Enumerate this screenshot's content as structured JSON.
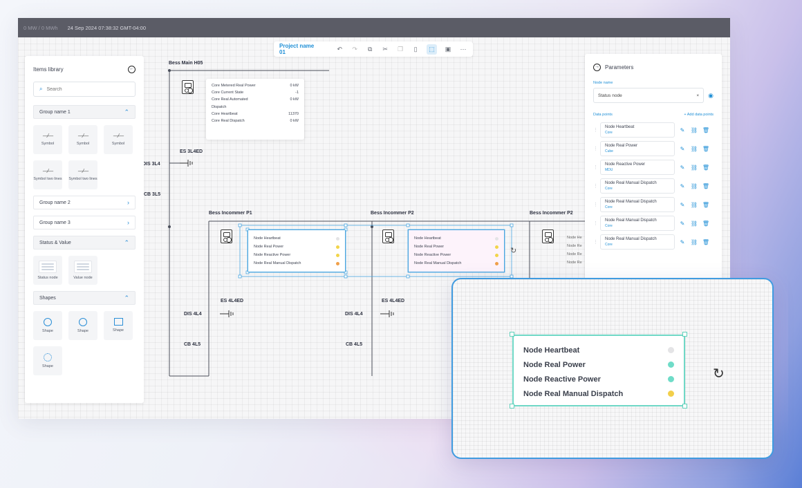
{
  "topbar": {
    "mw": "0 MW / 0 MWh",
    "datetime": "24 Sep 2024 07:38:32 GMT-04:00"
  },
  "toolbar": {
    "project_name": "Project name 01",
    "icons": [
      "undo-icon",
      "redo-icon",
      "copy-icon",
      "cut-icon",
      "duplicate-icon",
      "paste-icon",
      "select-icon",
      "save-icon",
      "more-icon"
    ]
  },
  "library": {
    "title": "Items library",
    "search_placeholder": "Search",
    "group1": "Group name 1",
    "symbols": [
      "Symbol",
      "Symbol",
      "Symbol",
      "Symbol two lines",
      "Symbol two lines"
    ],
    "group2": "Group name 2",
    "group3": "Group name 3",
    "status_value": "Status & Value",
    "nodes": [
      "Status node",
      "Value node"
    ],
    "shapes": "Shapes",
    "shape_items": [
      "Shape",
      "Shape",
      "Shape",
      "Shape"
    ]
  },
  "params": {
    "title": "Parameters",
    "node_name_label": "Node name",
    "node_name_value": "Status node",
    "data_points_label": "Data points",
    "add_label": "+ Add data points",
    "items": [
      {
        "name": "Node Heartbeat",
        "tag": "Core"
      },
      {
        "name": "Node Real Power",
        "tag": "Cube"
      },
      {
        "name": "Node Reactive Power",
        "tag": "MDU"
      },
      {
        "name": "Node Real Manual Dispatch",
        "tag": "Core"
      },
      {
        "name": "Node Real Manual Dispatch",
        "tag": "Core"
      },
      {
        "name": "Node Real Manual Dispatch",
        "tag": "Core"
      },
      {
        "name": "Node Real Manual Dispatch",
        "tag": "Core"
      }
    ]
  },
  "diagram": {
    "main_bus": "Bess Main H05",
    "es_top": "ES 3L4ED",
    "dis_top": "DIS 3L4",
    "cb_top": "CB 3L5",
    "incomer1": "Bess Incommer P1",
    "incomer2": "Bess Incommer P2",
    "incomer3": "Bess Incommer P2",
    "es1": "ES 4L4ED",
    "dis1": "DIS 4L4",
    "cb1": "CB 4L5",
    "es2": "ES 4L4ED",
    "dis2": "DIS 4L4",
    "cb2": "CB 4L5",
    "tooltip": [
      {
        "k": "Core Metered Real Power",
        "v": "0 kW"
      },
      {
        "k": "Core Current State",
        "v": "-1"
      },
      {
        "k": "Core Real Automated",
        "v": "0 kW"
      },
      {
        "k": "Dispatch",
        "v": ""
      },
      {
        "k": "Core Heartbeat",
        "v": "11370"
      },
      {
        "k": "Core Real Dispatch",
        "v": "0 kW"
      }
    ],
    "status_rows": [
      "Node Heartbeat",
      "Node Real Power",
      "Node Reactive Power",
      "Node Real Manual Dispatch"
    ],
    "status_colors_1": [
      "#e4e4e6",
      "#f2d54a",
      "#f2d54a",
      "#f0a04a"
    ],
    "status_colors_2": [
      "#e4e4e6",
      "#f2d54a",
      "#f2d54a",
      "#f0a04a"
    ],
    "partial_rows": [
      "Node He",
      "Node Re",
      "Node Re",
      "Node Re"
    ]
  },
  "zoom": {
    "rows": [
      "Node Heartbeat",
      "Node Real Power",
      "Node Reactive Power",
      "Node Real Manual Dispatch"
    ],
    "colors": [
      "#e4e4e6",
      "#6fdcc8",
      "#6fdcc8",
      "#f2cf4a"
    ]
  }
}
